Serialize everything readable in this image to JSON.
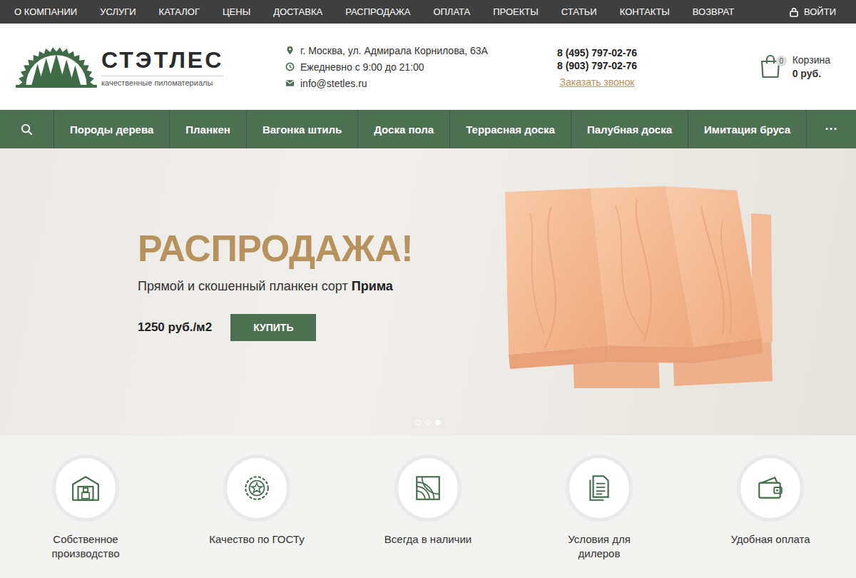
{
  "top_menu": {
    "items": [
      "О КОМПАНИИ",
      "УСЛУГИ",
      "КАТАЛОГ",
      "ЦЕНЫ",
      "ДОСТАВКА",
      "РАСПРОДАЖА",
      "ОПЛАТА",
      "ПРОЕКТЫ",
      "СТАТЬИ",
      "КОНТАКТЫ",
      "ВОЗВРАТ"
    ],
    "login": "ВОЙТИ"
  },
  "header": {
    "logo": {
      "name": "СТЭТЛЕС",
      "tagline": "качественные пиломатериалы"
    },
    "contacts": {
      "address": "г. Москва, ул. Адмирала Корнилова, 63А",
      "hours": "Ежедневно с 9:00 до 21:00",
      "email": "info@stetles.ru"
    },
    "phones": [
      "8 (495) 797-02-76",
      "8 (903) 797-02-76"
    ],
    "callback": "Заказать звонок",
    "cart": {
      "count": "0",
      "label": "Корзина",
      "total": "0 руб."
    }
  },
  "nav": {
    "items": [
      "Породы дерева",
      "Планкен",
      "Вагонка штиль",
      "Доска пола",
      "Террасная доска",
      "Палубная доска",
      "Имитация бруса"
    ],
    "more": "···"
  },
  "hero": {
    "title": "РАСПРОДАЖА!",
    "subtitle": "Прямой и скошенный планкен сорт",
    "subtitle_bold": "Прима",
    "price": "1250 руб./м2",
    "button": "КУПИТЬ",
    "slides": [
      {
        "selected": false
      },
      {
        "selected": false
      },
      {
        "selected": true
      }
    ]
  },
  "features": [
    {
      "label": "Собственное производство"
    },
    {
      "label": "Качество по ГОСТу"
    },
    {
      "label": "Всегда в наличии"
    },
    {
      "label": "Условия для дилеров"
    },
    {
      "label": "Удобная оплата"
    }
  ]
}
